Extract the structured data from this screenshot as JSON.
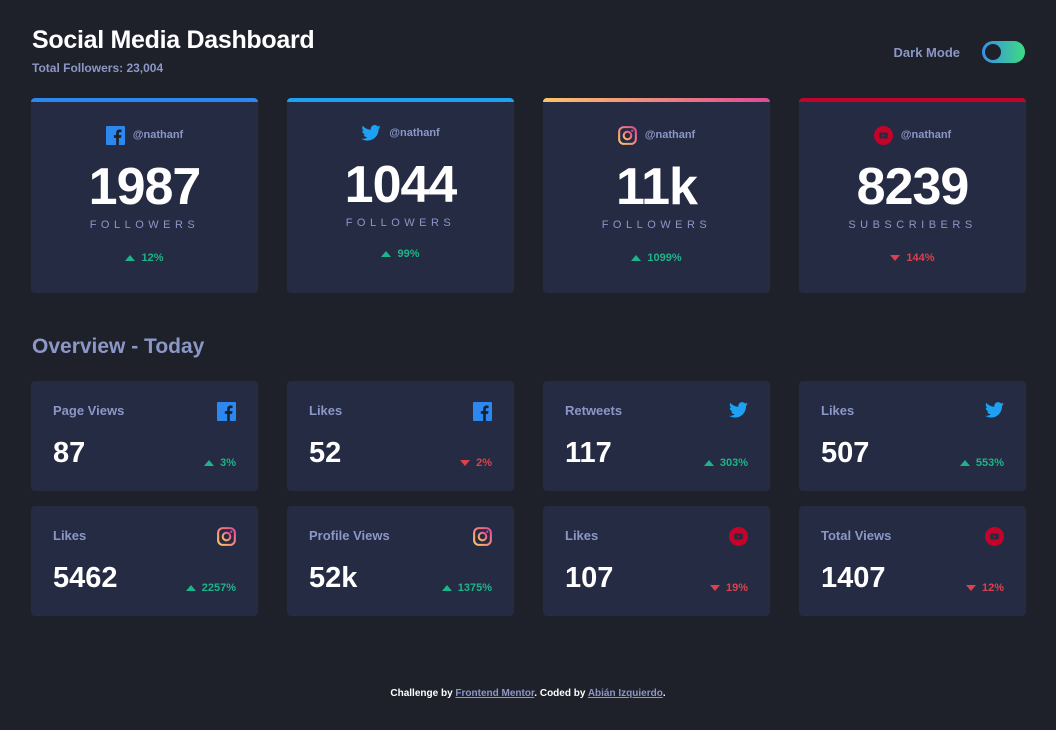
{
  "header": {
    "title": "Social Media Dashboard",
    "total_followers_label": "Total Followers: 23,004",
    "dark_mode_label": "Dark Mode",
    "dark_mode_on": true
  },
  "colors": {
    "background": "#1e202a",
    "card": "#252b43",
    "text_muted": "#8b97c6",
    "up": "#1db489",
    "down": "#dc414c",
    "facebook": "#2c87ef",
    "twitter": "#1da1f2",
    "instagram_gradient": [
      "#fdc468",
      "#df4996"
    ],
    "youtube": "#c4032a"
  },
  "followers": [
    {
      "platform": "facebook",
      "icon": "facebook-icon",
      "handle": "@nathanf",
      "count": "1987",
      "label": "FOLLOWERS",
      "change": "12%",
      "direction": "up"
    },
    {
      "platform": "twitter",
      "icon": "twitter-icon",
      "handle": "@nathanf",
      "count": "1044",
      "label": "FOLLOWERS",
      "change": "99%",
      "direction": "up"
    },
    {
      "platform": "instagram",
      "icon": "instagram-icon",
      "handle": "@nathanf",
      "count": "11k",
      "label": "FOLLOWERS",
      "change": "1099%",
      "direction": "up"
    },
    {
      "platform": "youtube",
      "icon": "youtube-icon",
      "handle": "@nathanf",
      "count": "8239",
      "label": "SUBSCRIBERS",
      "change": "144%",
      "direction": "down"
    }
  ],
  "overview": {
    "title": "Overview - Today",
    "cards": [
      {
        "metric": "Page Views",
        "platform": "facebook",
        "value": "87",
        "change": "3%",
        "direction": "up"
      },
      {
        "metric": "Likes",
        "platform": "facebook",
        "value": "52",
        "change": "2%",
        "direction": "down"
      },
      {
        "metric": "Retweets",
        "platform": "twitter",
        "value": "117",
        "change": "303%",
        "direction": "up"
      },
      {
        "metric": "Likes",
        "platform": "twitter",
        "value": "507",
        "change": "553%",
        "direction": "up"
      },
      {
        "metric": "Likes",
        "platform": "instagram",
        "value": "5462",
        "change": "2257%",
        "direction": "up"
      },
      {
        "metric": "Profile Views",
        "platform": "instagram",
        "value": "52k",
        "change": "1375%",
        "direction": "up"
      },
      {
        "metric": "Likes",
        "platform": "youtube",
        "value": "107",
        "change": "19%",
        "direction": "down"
      },
      {
        "metric": "Total Views",
        "platform": "youtube",
        "value": "1407",
        "change": "12%",
        "direction": "down"
      }
    ]
  },
  "footer": {
    "challenge_prefix": "Challenge by ",
    "challenge_link": "Frontend Mentor",
    "coded_prefix": ". Coded by ",
    "author_link": "Abián Izquierdo",
    "suffix": "."
  }
}
